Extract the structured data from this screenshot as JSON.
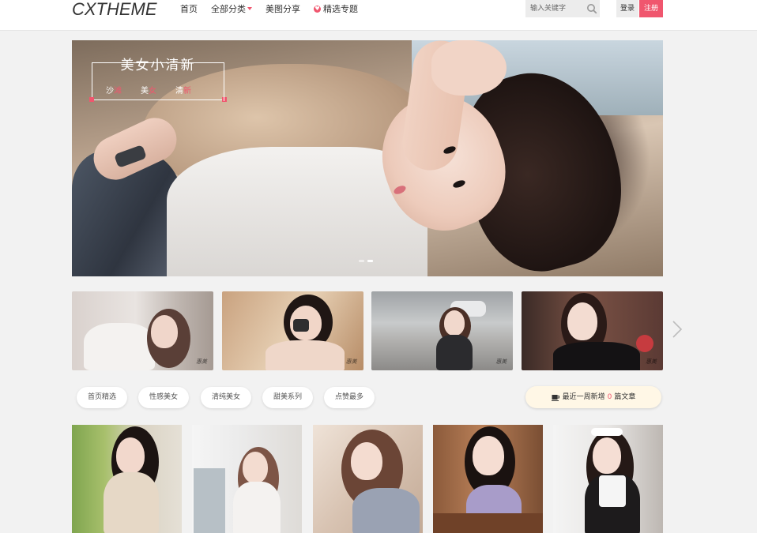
{
  "header": {
    "logo": "CXTHEME",
    "nav": [
      {
        "label": "首页"
      },
      {
        "label": "全部分类"
      },
      {
        "label": "美图分享"
      },
      {
        "label": "精选专题"
      }
    ],
    "search": {
      "placeholder": "输入关键字"
    },
    "login_label": "登录",
    "register_label": "注册"
  },
  "hero": {
    "title": "美女小清新",
    "tags": [
      {
        "pre": "沙",
        "post": "滩"
      },
      {
        "pre": "美",
        "post": "女"
      },
      {
        "pre": "清",
        "post": "新"
      }
    ],
    "slides_total": 2,
    "active_slide": 2
  },
  "thumbnails": [
    {
      "signature": "惠美"
    },
    {
      "signature": "惠美"
    },
    {
      "signature": "惠美"
    },
    {
      "signature": "惠美"
    }
  ],
  "filters": [
    {
      "label": "首页精选"
    },
    {
      "label": "性感美女"
    },
    {
      "label": "清纯美女"
    },
    {
      "label": "甜美系列"
    },
    {
      "label": "点赞最多"
    }
  ],
  "recent": {
    "prefix": "最近一周新增",
    "count": "0",
    "suffix": "篇文章"
  },
  "colors": {
    "accent": "#f0566e",
    "background": "#f2f2f2",
    "header": "#ffffff"
  }
}
